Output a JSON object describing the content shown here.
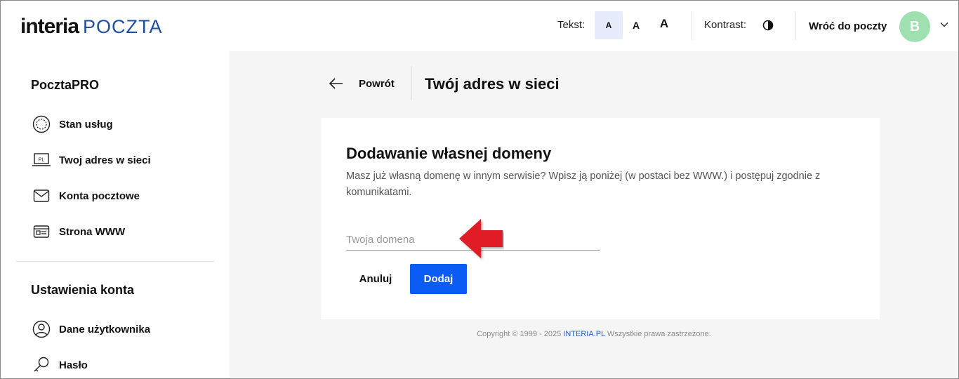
{
  "header": {
    "logo_brand": "interia",
    "logo_product": "POCZTA",
    "text_size_label": "Tekst:",
    "text_sizes": [
      "A",
      "A",
      "A"
    ],
    "contrast_label": "Kontrast:",
    "back_to_mail": "Wróć do poczty",
    "avatar_letter": "B"
  },
  "sidebar": {
    "section1_title": "PocztaPRO",
    "section1_items": [
      {
        "label": "Stan usług",
        "icon": "service-status-icon"
      },
      {
        "label": "Twoj adres w sieci",
        "icon": "laptop-pl-icon"
      },
      {
        "label": "Konta pocztowe",
        "icon": "envelope-icon"
      },
      {
        "label": "Strona WWW",
        "icon": "website-icon"
      }
    ],
    "section2_title": "Ustawienia konta",
    "section2_items": [
      {
        "label": "Dane użytkownika",
        "icon": "user-icon"
      },
      {
        "label": "Hasło",
        "icon": "key-icon"
      }
    ]
  },
  "main": {
    "back_label": "Powrót",
    "page_title": "Twój adres w sieci",
    "card": {
      "title": "Dodawanie własnej domeny",
      "description": "Masz już własną domenę w innym serwisie? Wpisz ją poniżej (w postaci bez WWW.) i postępuj zgodnie z komunikatami.",
      "input_placeholder": "Twoja domena",
      "input_value": "",
      "cancel_label": "Anuluj",
      "add_label": "Dodaj"
    },
    "footer": {
      "prefix": "Copyright © 1999 - 2025 ",
      "brand": "INTERIA.PL",
      "suffix": " Wszystkie prawa zastrzeżone."
    }
  },
  "colors": {
    "accent_blue": "#0a5cf5",
    "avatar_green": "#9ee0b0",
    "annotation_red": "#e01f26",
    "active_size_bg": "#e6ecfb"
  }
}
